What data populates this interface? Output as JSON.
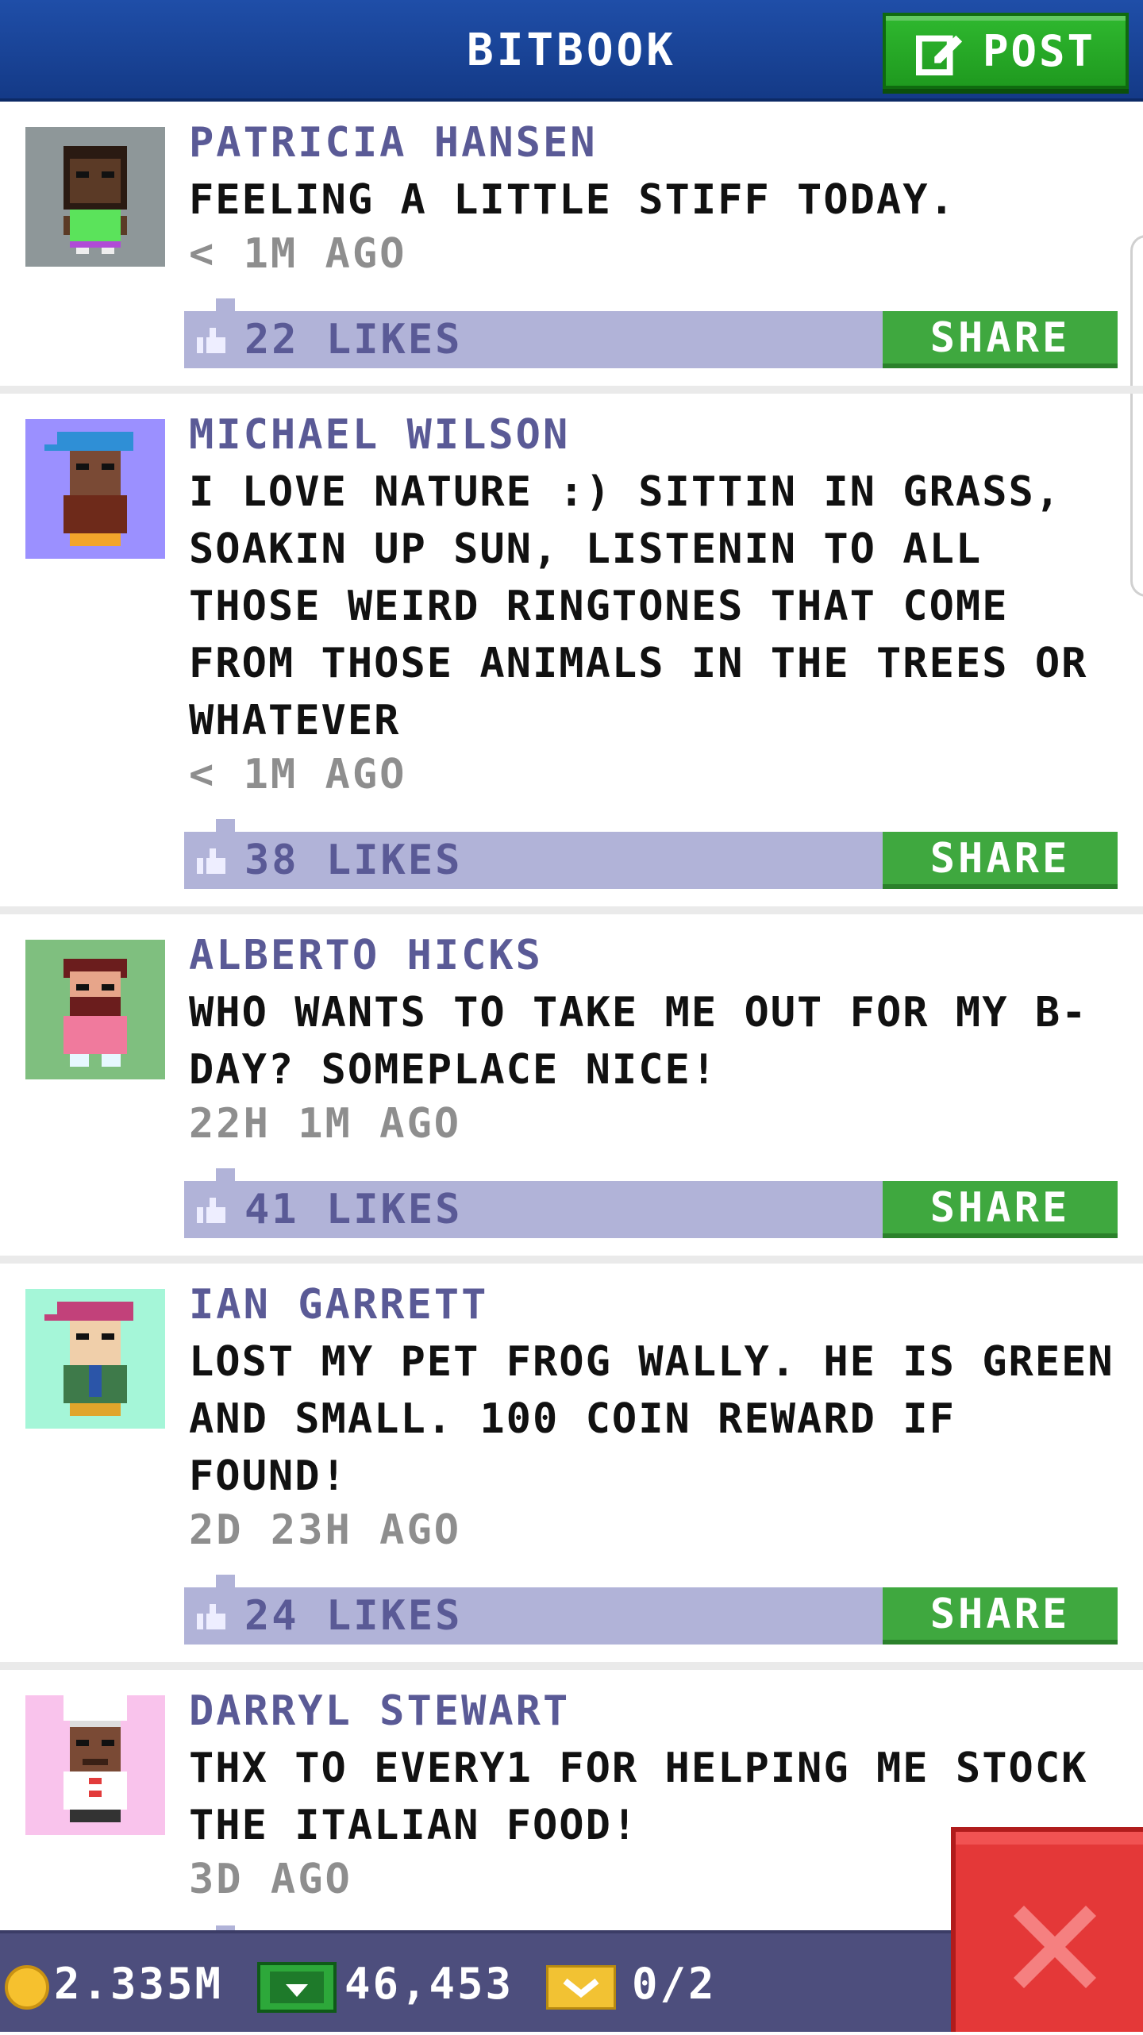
{
  "header": {
    "title": "BITBOOK",
    "post_label": "POST",
    "post_icon": "edit-icon",
    "color": "#1f4ea8"
  },
  "posts": [
    {
      "name": "PATRICIA HANSEN",
      "text": "FEELING A LITTLE STIFF TODAY.",
      "time": "< 1M AGO",
      "likes": "22 LIKES",
      "share": "SHARE",
      "avatar_bg": "#8e9799"
    },
    {
      "name": "MICHAEL WILSON",
      "text": "I LOVE NATURE :) SITTIN IN GRASS, SOAKIN UP SUN, LISTENIN TO ALL THOSE WEIRD RINGTONES THAT COME FROM THOSE ANIMALS IN THE TREES OR WHATEVER",
      "time": "< 1M AGO",
      "likes": "38 LIKES",
      "share": "SHARE",
      "avatar_bg": "#9b90ff"
    },
    {
      "name": "ALBERTO HICKS",
      "text": "WHO WANTS TO TAKE ME OUT FOR MY B-DAY? SOMEPLACE NICE!",
      "time": "22H 1M AGO",
      "likes": "41 LIKES",
      "share": "SHARE",
      "avatar_bg": "#7fbf7f"
    },
    {
      "name": "IAN GARRETT",
      "text": "LOST MY PET FROG WALLY. HE IS GREEN AND SMALL. 100 COIN REWARD IF FOUND!",
      "time": "2D 23H AGO",
      "likes": "24 LIKES",
      "share": "SHARE",
      "avatar_bg": "#a5f6d8"
    },
    {
      "name": "DARRYL STEWART",
      "text": "THX TO EVERY1 FOR HELPING ME STOCK THE ITALIAN FOOD!",
      "time": "3D AGO",
      "likes": "",
      "share": "",
      "avatar_bg": "#f9c3ec"
    }
  ],
  "statusbar": {
    "coins": "2.335M",
    "bux": "46,453",
    "tickets": "0/2",
    "coin_icon": "coin-icon",
    "cash_icon": "cash-icon",
    "ticket_icon": "ticket-icon"
  },
  "close_icon": "close-icon"
}
